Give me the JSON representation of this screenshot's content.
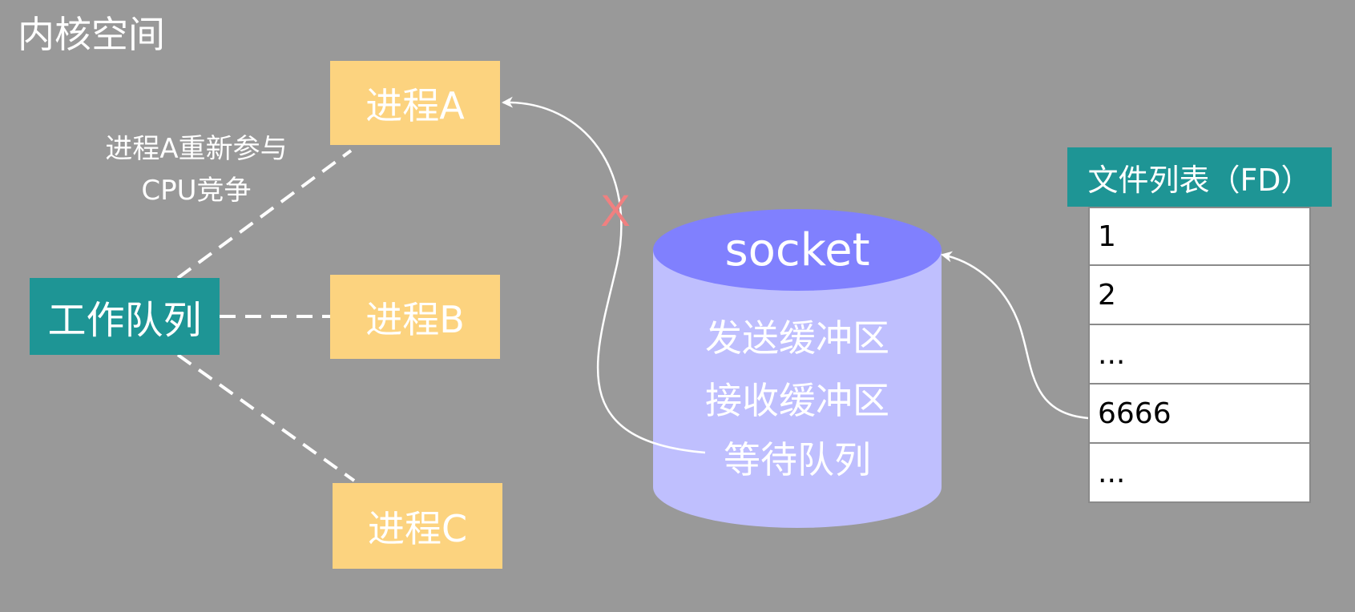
{
  "region_label": "内核空间",
  "processes": {
    "a": "进程A",
    "b": "进程B",
    "c": "进程C"
  },
  "work_queue": "工作队列",
  "note": "进程A重新参与CPU竞争",
  "socket": {
    "title": "socket",
    "send_buffer": "发送缓冲区",
    "recv_buffer": "接收缓冲区",
    "wait_queue": "等待队列"
  },
  "cross_mark": "X",
  "fd_table": {
    "header": "文件列表（FD）",
    "rows": [
      "1",
      "2",
      "...",
      "6666",
      "..."
    ]
  },
  "colors": {
    "background": "#999999",
    "process_fill": "#fcd37f",
    "teal": "#1e9595",
    "socket_body": "#bfbffe",
    "socket_top": "#8080fe",
    "cross": "#f08080"
  }
}
